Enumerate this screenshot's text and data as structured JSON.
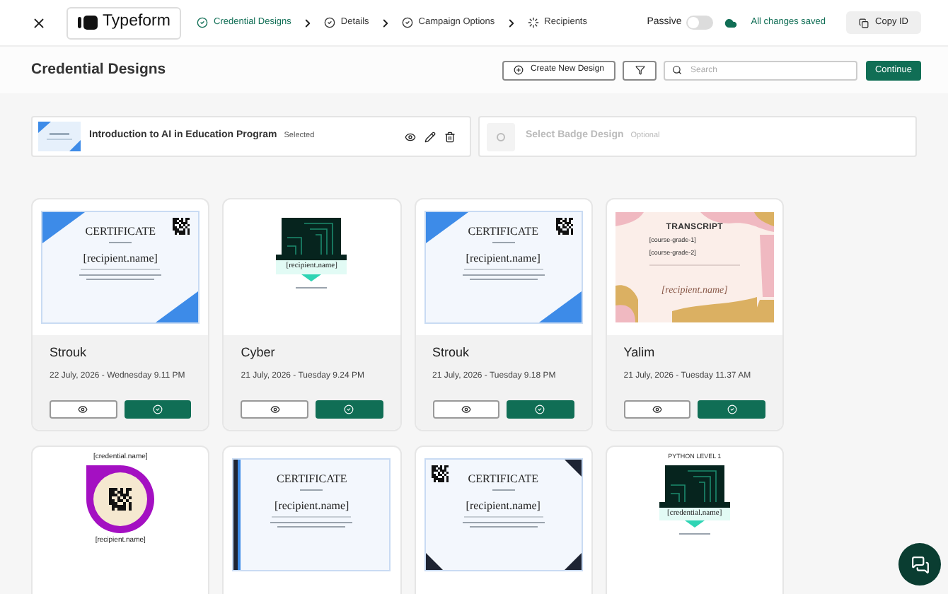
{
  "header": {
    "logo": "Typeform",
    "steps": [
      {
        "label": "Credential Designs",
        "selected": true,
        "kind": "check"
      },
      {
        "label": "Details",
        "selected": false,
        "kind": "check"
      },
      {
        "label": "Campaign Options",
        "selected": false,
        "kind": "check"
      },
      {
        "label": "Recipients",
        "selected": false,
        "kind": "pending"
      }
    ],
    "passive": {
      "label": "Passive",
      "on": false
    },
    "save_status": "All changes saved",
    "copy_button": "Copy ID"
  },
  "page": {
    "title": "Credential Designs",
    "create_button": "Create New Design",
    "search": {
      "placeholder": "Search"
    },
    "continue_button": "Continue"
  },
  "selection": {
    "design": {
      "title": "Introduction to AI in Education Program",
      "badge": "Selected"
    },
    "badge_slot": {
      "title": "Select Badge Design",
      "note": "Optional"
    }
  },
  "designs": [
    {
      "name": "Strouk",
      "date": "22 July, 2026 - Wednesday 9.11 PM",
      "thumbnail": {
        "kind": "wave",
        "title": "CERTIFICATE",
        "field": "[recipient.name]"
      }
    },
    {
      "name": "Cyber",
      "date": "21 July, 2026 - Tuesday 9.24 PM",
      "thumbnail": {
        "kind": "cyber",
        "field": "[recipient.name]"
      }
    },
    {
      "name": "Strouk",
      "date": "21 July, 2026 - Tuesday 9.18 PM",
      "thumbnail": {
        "kind": "wave",
        "title": "CERTIFICATE",
        "field": "[recipient.name]"
      }
    },
    {
      "name": "Yalim",
      "date": "21 July, 2026 - Tuesday 11.37 AM",
      "thumbnail": {
        "kind": "transcript",
        "title": "TRANSCRIPT",
        "lines": [
          "[course-grade-1]",
          "[course-grade-2]"
        ],
        "field": "[recipient.name]"
      }
    },
    {
      "thumbnail": {
        "kind": "badge",
        "heading": "[credential.name]",
        "field": "[recipient.name]"
      }
    },
    {
      "thumbnail": {
        "kind": "stripe",
        "title": "CERTIFICATE",
        "field": "[recipient.name]"
      }
    },
    {
      "thumbnail": {
        "kind": "corners",
        "title": "CERTIFICATE",
        "field": "[recipient.name]"
      }
    },
    {
      "thumbnail": {
        "kind": "cyber",
        "heading": "PYTHON LEVEL 1",
        "field": "[credential.name]"
      }
    }
  ]
}
